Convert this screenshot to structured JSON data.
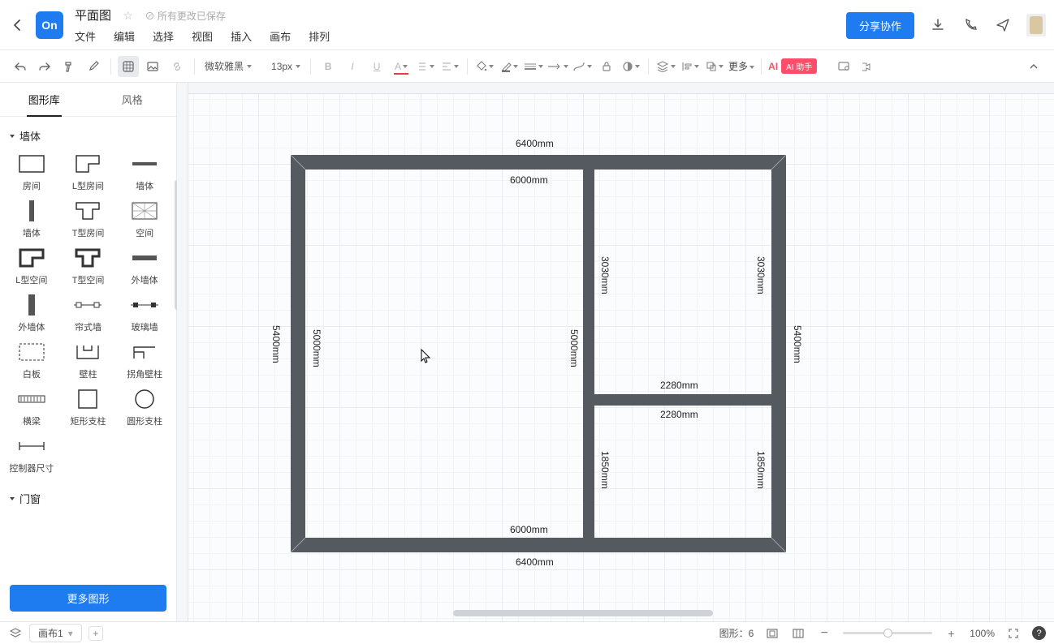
{
  "header": {
    "logo_text": "On",
    "title": "平面图",
    "saved_label": "所有更改已保存",
    "menu": [
      "文件",
      "编辑",
      "选择",
      "视图",
      "插入",
      "画布",
      "排列"
    ],
    "share_label": "分享协作"
  },
  "toolbar": {
    "font_family": "微软雅黑",
    "font_size": "13px",
    "more_label": "更多",
    "ai_label": "AI 助手",
    "ai_prefix": "AI"
  },
  "left": {
    "tabs": [
      "图形库",
      "风格"
    ],
    "sections": [
      {
        "title": "墙体",
        "items": [
          "房间",
          "L型房间",
          "墙体",
          "墙体",
          "T型房间",
          "空间",
          "L型空间",
          "T型空间",
          "外墙体",
          "外墙体",
          "帘式墙",
          "玻璃墙",
          "白板",
          "壁柱",
          "拐角壁柱",
          "横梁",
          "矩形支柱",
          "圆形支柱",
          "控制器尺寸"
        ]
      },
      {
        "title": "门窗",
        "items": []
      }
    ],
    "more_shapes_label": "更多图形"
  },
  "plan": {
    "dims": {
      "outer_w": "6400mm",
      "outer_h": "5400mm",
      "big_w": "6000mm",
      "big_h": "5000mm",
      "tr_w": "2280mm",
      "tr_h": "3030mm",
      "br_w": "2280mm",
      "br_h": "1850mm"
    }
  },
  "status": {
    "sheet_label": "画布1",
    "shape_count_label": "图形：",
    "shape_count": "6",
    "zoom_label": "100%"
  }
}
